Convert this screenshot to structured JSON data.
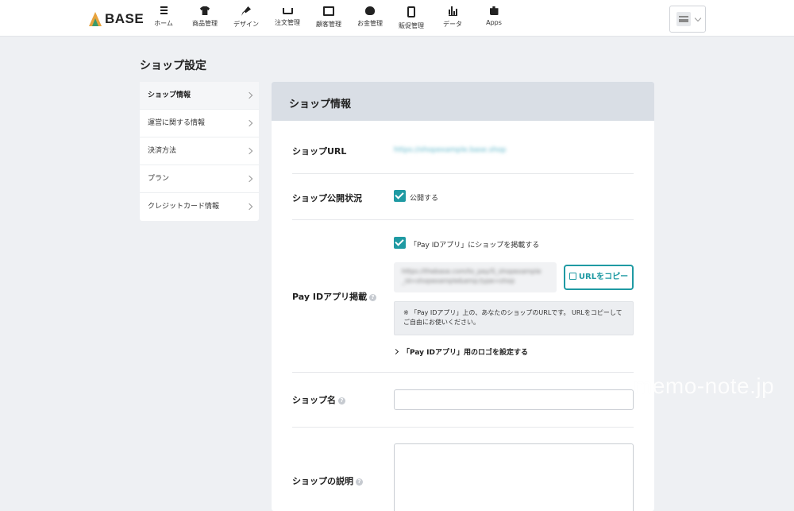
{
  "header": {
    "logo_text": "BASE",
    "nav": [
      {
        "label": "ホーム",
        "icon": "list-icon"
      },
      {
        "label": "商品管理",
        "icon": "shirt-icon"
      },
      {
        "label": "デザイン",
        "icon": "brush-icon"
      },
      {
        "label": "注文管理",
        "icon": "cart-icon"
      },
      {
        "label": "顧客管理",
        "icon": "id-card-icon"
      },
      {
        "label": "お金管理",
        "icon": "money-bag-icon"
      },
      {
        "label": "販促管理",
        "icon": "smartphone-icon"
      },
      {
        "label": "データ",
        "icon": "bar-chart-icon"
      },
      {
        "label": "Apps",
        "icon": "puzzle-icon"
      }
    ]
  },
  "page_title": "ショップ設定",
  "sidebar": {
    "items": [
      {
        "label": "ショップ情報",
        "active": true
      },
      {
        "label": "運営に関する情報",
        "active": false
      },
      {
        "label": "決済方法",
        "active": false
      },
      {
        "label": "プラン",
        "active": false
      },
      {
        "label": "クレジットカード情報",
        "active": false
      }
    ]
  },
  "panel": {
    "title": "ショップ情報",
    "shop_url": {
      "label": "ショップURL",
      "value": "https://shopexample.base.shop"
    },
    "publish": {
      "label": "ショップ公開状況",
      "checkbox_label": "公開する",
      "checked": true
    },
    "payid": {
      "label": "Pay IDアプリ掲載",
      "checkbox_label": "「Pay IDアプリ」にショップを掲載する",
      "checked": true,
      "url_line1": "https://thebase.com/to_pay/S_shopexample",
      "url_line2": "_id=shopexample&amp;type=shop",
      "copy_button": "URLをコピー",
      "note": "※ 「Pay IDアプリ」上の、あなたのショップのURLです。 URLをコピーしてご自由にお使いください。",
      "logo_link": "「Pay IDアプリ」用のロゴを設定する"
    },
    "shop_name": {
      "label": "ショップ名",
      "value": ""
    },
    "description": {
      "label": "ショップの説明",
      "value": ""
    }
  },
  "watermark": "memo-note.jp",
  "colors": {
    "accent": "#1f9aa3",
    "panel_header": "#d9dee5",
    "background": "#eef0f3"
  }
}
